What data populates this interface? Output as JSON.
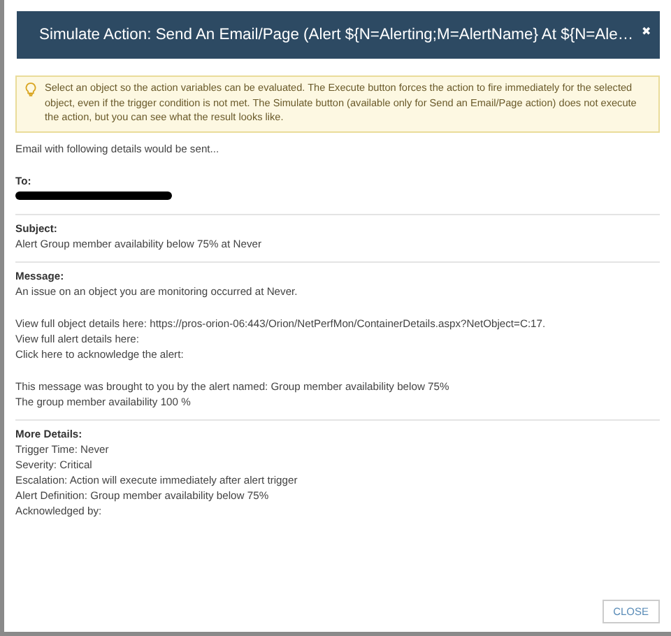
{
  "dialog": {
    "title": "Simulate Action: Send An Email/Page (Alert ${N=Alerting;M=AlertName} At ${N=Ale…",
    "close_glyph": "✖"
  },
  "info": "Select an object so the action variables can be evaluated. The Execute button forces the action to fire immediately for the selected object, even if the trigger condition is not met. The Simulate button (available only for Send an Email/Page action) does not execute the action, but you can see what the result looks like.",
  "intro": "Email with following details would be sent...",
  "sections": [
    {
      "label": "To:",
      "kind": "redacted"
    },
    {
      "label": "Subject:",
      "kind": "text",
      "paragraphs": [
        [
          "Alert Group member availability below 75% at Never"
        ]
      ]
    },
    {
      "label": "Message:",
      "kind": "text",
      "paragraphs": [
        [
          "An issue on an object you are monitoring occurred at Never."
        ],
        [
          "View full object details here: https://pros-orion-06:443/Orion/NetPerfMon/ContainerDetails.aspx?NetObject=C:17.",
          "View full alert details here:",
          "Click here to acknowledge the alert:"
        ],
        [
          "This message was brought to you by the alert named: Group member availability below 75%",
          "The group member availability 100 %"
        ]
      ]
    },
    {
      "label": "More Details:",
      "kind": "text",
      "paragraphs": [
        [
          "Trigger Time: Never",
          "Severity: Critical",
          "Escalation: Action will execute immediately after alert trigger",
          "Alert Definition: Group member availability below 75%",
          "Acknowledged by:"
        ]
      ]
    }
  ],
  "buttons": [
    "CLOSE"
  ]
}
